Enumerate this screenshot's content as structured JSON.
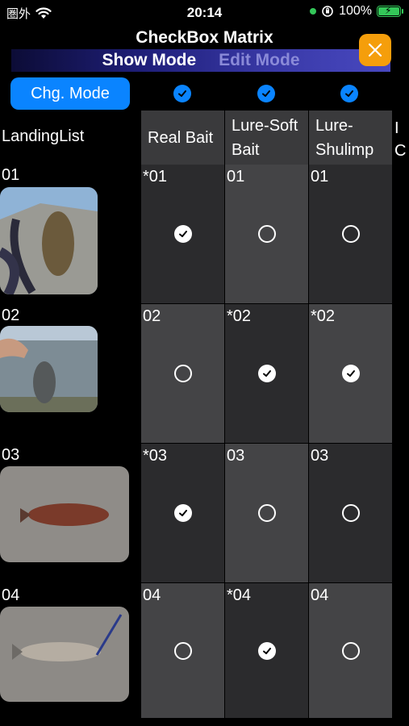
{
  "status": {
    "carrier": "圏外",
    "time": "20:14",
    "battery": "100%"
  },
  "title": "CheckBox Matrix",
  "modes": {
    "show": "Show Mode",
    "edit": "Edit Mode"
  },
  "chg_mode_label": "Chg. Mode",
  "landing_label": "LandingList",
  "columns": [
    {
      "line1": "Real Bait",
      "line2": ""
    },
    {
      "line1": "Lure-Soft",
      "line2": "Bait"
    },
    {
      "line1": "Lure-",
      "line2": "Shulimp"
    }
  ],
  "partial_column": {
    "line1": "I",
    "line2": "C"
  },
  "rows": [
    {
      "num": "01",
      "cells": [
        {
          "label": "*01",
          "checked": true
        },
        {
          "label": "01",
          "checked": false
        },
        {
          "label": "01",
          "checked": false
        }
      ]
    },
    {
      "num": "02",
      "cells": [
        {
          "label": "02",
          "checked": false
        },
        {
          "label": "*02",
          "checked": true
        },
        {
          "label": "*02",
          "checked": true
        }
      ]
    },
    {
      "num": "03",
      "cells": [
        {
          "label": "*03",
          "checked": true
        },
        {
          "label": "03",
          "checked": false
        },
        {
          "label": "03",
          "checked": false
        }
      ]
    },
    {
      "num": "04",
      "cells": [
        {
          "label": "04",
          "checked": false
        },
        {
          "label": "*04",
          "checked": true
        },
        {
          "label": "04",
          "checked": false
        }
      ]
    }
  ],
  "colors": {
    "accent": "#0a84ff",
    "close": "#f59e0b",
    "cell_dark": "#2b2b2d",
    "cell_light": "#444446"
  }
}
